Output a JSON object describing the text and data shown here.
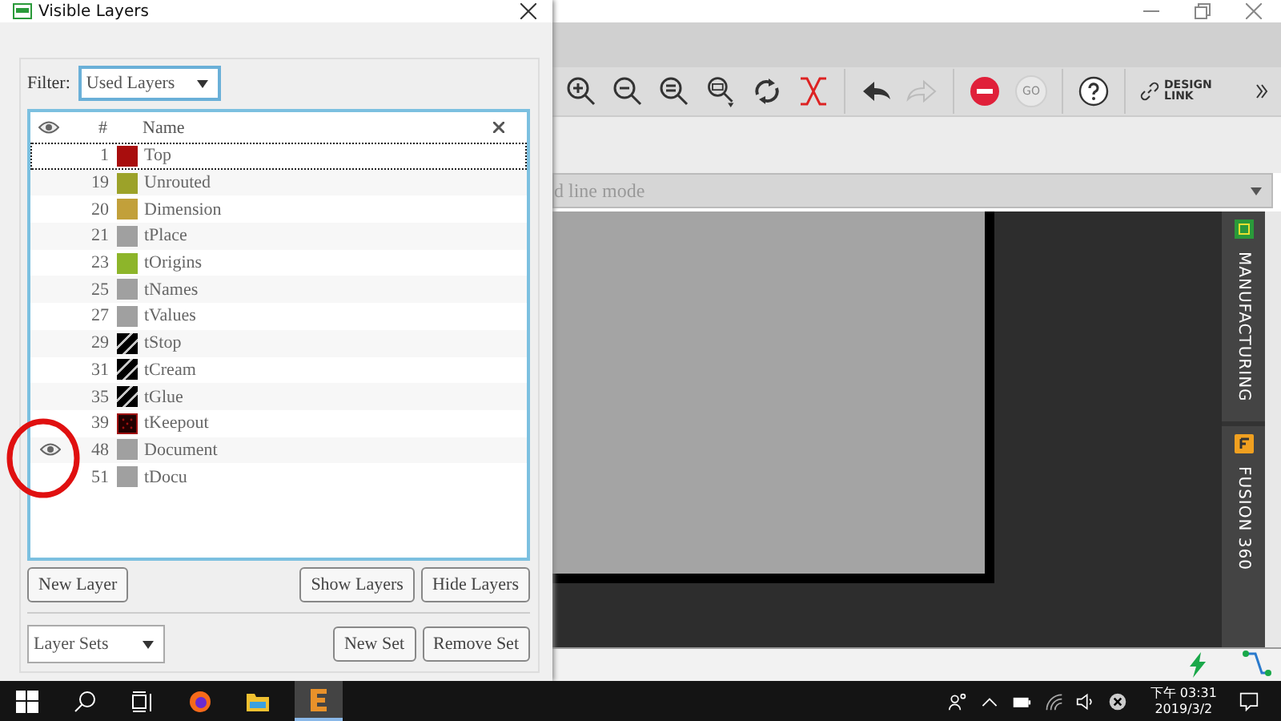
{
  "dialog": {
    "title": "Visible Layers",
    "filter_label": "Filter:",
    "filter_value": "Used Layers",
    "columns": {
      "number": "#",
      "name": "Name"
    },
    "layers": [
      {
        "number": "1",
        "name": "Top",
        "color": "#a80d0d",
        "kind": "solid",
        "visible": false,
        "selected": true
      },
      {
        "number": "19",
        "name": "Unrouted",
        "color": "#9ca229",
        "kind": "solid",
        "visible": false,
        "selected": false
      },
      {
        "number": "20",
        "name": "Dimension",
        "color": "#c2a03a",
        "kind": "solid",
        "visible": false,
        "selected": false
      },
      {
        "number": "21",
        "name": "tPlace",
        "color": "#a0a0a0",
        "kind": "solid",
        "visible": false,
        "selected": false
      },
      {
        "number": "23",
        "name": "tOrigins",
        "color": "#8db52a",
        "kind": "solid",
        "visible": false,
        "selected": false
      },
      {
        "number": "25",
        "name": "tNames",
        "color": "#a0a0a0",
        "kind": "solid",
        "visible": false,
        "selected": false
      },
      {
        "number": "27",
        "name": "tValues",
        "color": "#a0a0a0",
        "kind": "solid",
        "visible": false,
        "selected": false
      },
      {
        "number": "29",
        "name": "tStop",
        "color": "#c8c8c8",
        "kind": "hatch",
        "visible": false,
        "selected": false
      },
      {
        "number": "31",
        "name": "tCream",
        "color": "#c8c8c8",
        "kind": "hatch",
        "visible": false,
        "selected": false
      },
      {
        "number": "35",
        "name": "tGlue",
        "color": "#c8c8c8",
        "kind": "hatch",
        "visible": false,
        "selected": false
      },
      {
        "number": "39",
        "name": "tKeepout",
        "color": "#a01010",
        "kind": "dots",
        "visible": false,
        "selected": false
      },
      {
        "number": "48",
        "name": "Document",
        "color": "#a0a0a0",
        "kind": "solid",
        "visible": true,
        "selected": false
      },
      {
        "number": "51",
        "name": "tDocu",
        "color": "#a0a0a0",
        "kind": "solid",
        "visible": false,
        "selected": false
      }
    ],
    "layer_buttons_left": [
      "New Layer"
    ],
    "layer_buttons_right": [
      "Show Layers",
      "Hide Layers"
    ],
    "sets_dropdown": "Layer Sets",
    "set_buttons": [
      "New Set",
      "Remove Set"
    ]
  },
  "app": {
    "go_label": "GO",
    "design_link": "DESIGN LINK",
    "mode_dropdown": "d line mode",
    "side_tabs": [
      {
        "label": "MANUFACTURING",
        "kind": "chip"
      },
      {
        "label": "FUSION 360",
        "kind": "fusion"
      }
    ]
  },
  "taskbar": {
    "time": "下午 03:31",
    "date": "2019/3/2"
  }
}
